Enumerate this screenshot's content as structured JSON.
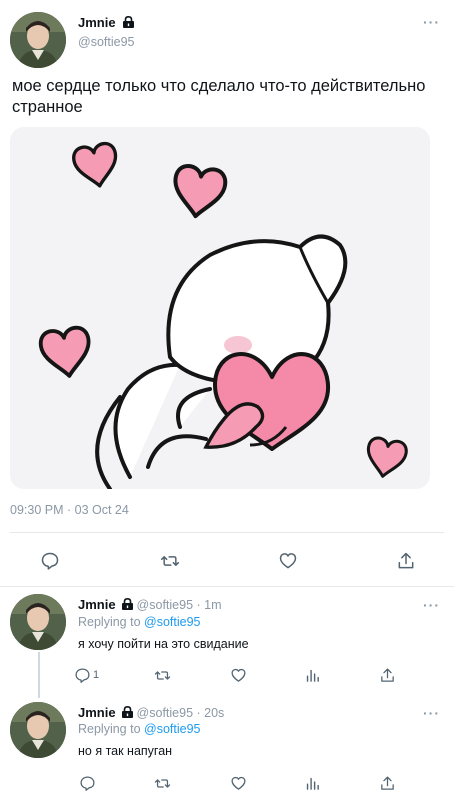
{
  "main_tweet": {
    "author_name": "Jmnie",
    "author_handle": "@softie95",
    "text": "мое сердце только что сделало что-то действительно странное",
    "timestamp": "09:30 PM · 03 Oct 24"
  },
  "replies": [
    {
      "author_name": "Jmnie",
      "author_handle": "@softie95",
      "age": "· 1m",
      "replying_prefix": "Replying to",
      "replying_to": "@softie95",
      "text": "я хочу пойти на это свидание",
      "reply_count": "1"
    },
    {
      "author_name": "Jmnie",
      "author_handle": "@softie95",
      "age": "· 20s",
      "replying_prefix": "Replying to",
      "replying_to": "@softie95",
      "text": "но я так напуган",
      "reply_count": ""
    }
  ],
  "more_glyph": "···",
  "colors": {
    "link": "#1d9bf0",
    "muted": "#8b98a5",
    "heart_pink": "#f59bb3",
    "heart_outline": "#151515"
  },
  "icons": [
    "lock-icon",
    "more-icon",
    "reply-icon",
    "retweet-icon",
    "like-icon",
    "views-icon",
    "share-icon"
  ]
}
